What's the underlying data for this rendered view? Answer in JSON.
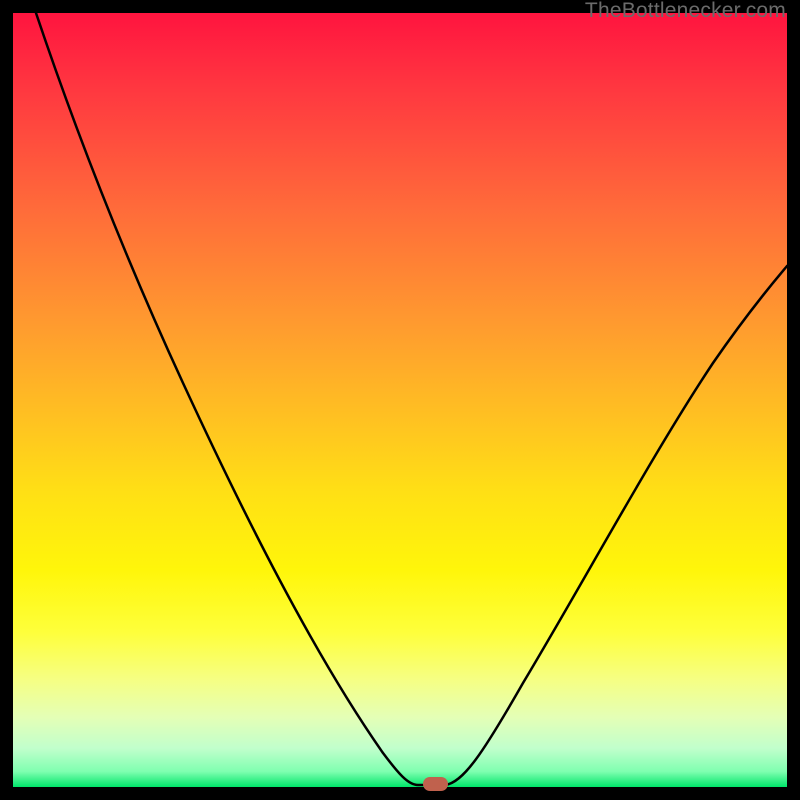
{
  "watermark": {
    "text": "TheBottlenecker.com"
  },
  "chart_data": {
    "type": "line",
    "title": "",
    "xlabel": "",
    "ylabel": "",
    "xlim": [
      0,
      100
    ],
    "ylim": [
      0,
      100
    ],
    "x": [
      0,
      6,
      12,
      18,
      24,
      30,
      36,
      42,
      48,
      51,
      54,
      55,
      58,
      64,
      70,
      76,
      82,
      88,
      94,
      100
    ],
    "y": [
      100,
      86,
      73,
      62,
      52,
      42,
      32,
      22,
      10,
      3,
      0,
      0,
      3,
      12,
      22,
      32,
      42,
      51,
      58,
      64
    ],
    "marker": {
      "x": 54.5,
      "y": 0
    },
    "gradient_stops": [
      {
        "pos": 0.0,
        "color": "#ff143f"
      },
      {
        "pos": 0.25,
        "color": "#ff6a3a"
      },
      {
        "pos": 0.52,
        "color": "#ffc022"
      },
      {
        "pos": 0.8,
        "color": "#feff3b"
      },
      {
        "pos": 1.0,
        "color": "#00e56a"
      }
    ]
  }
}
